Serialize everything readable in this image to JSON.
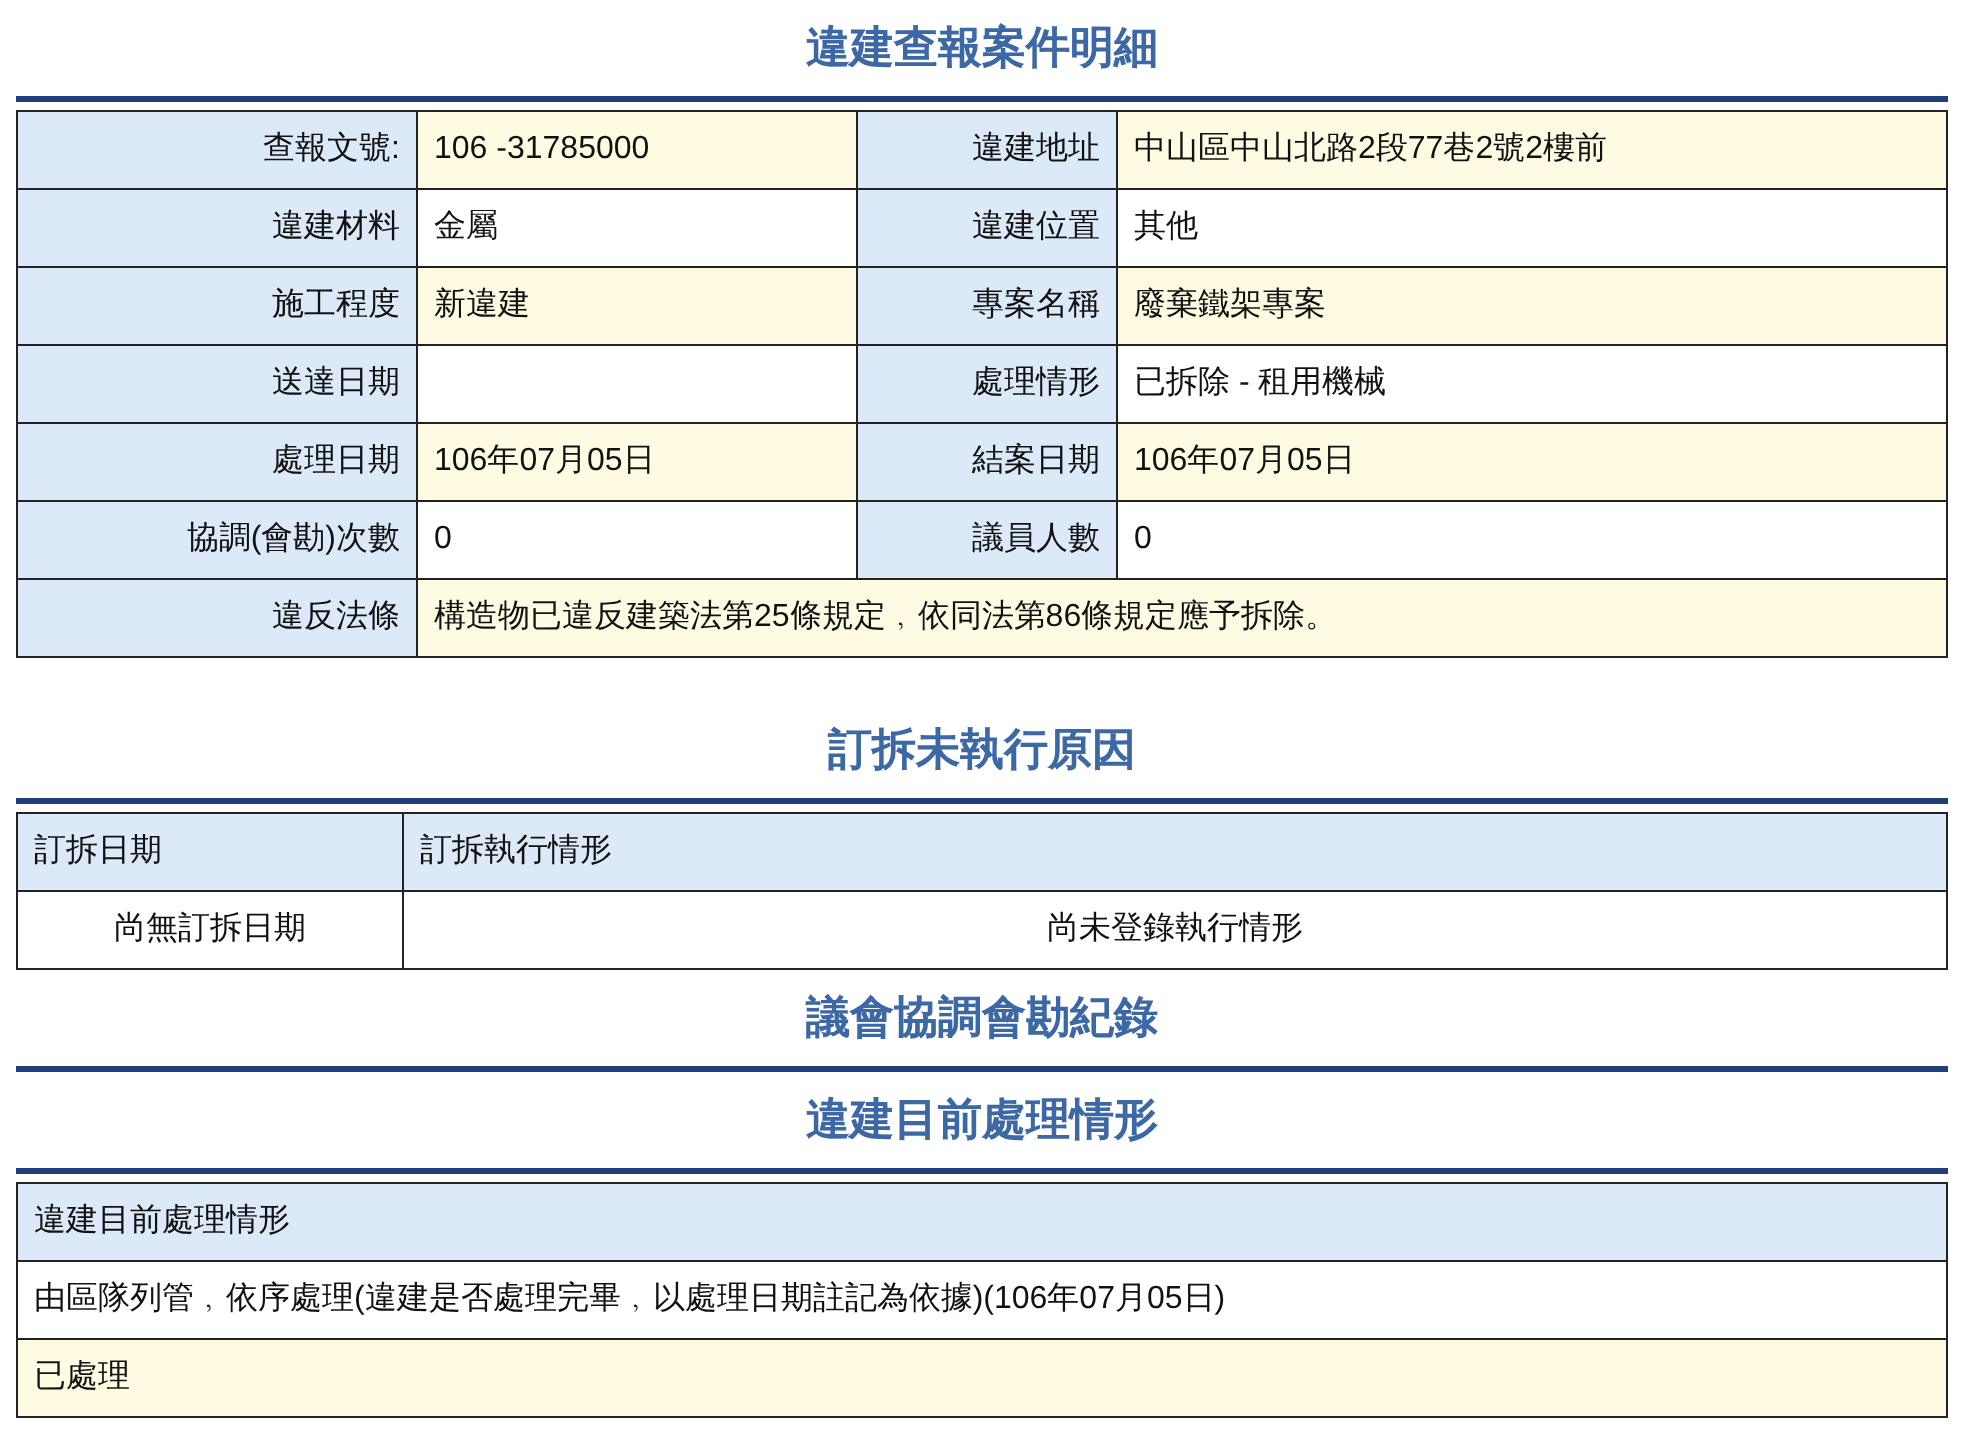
{
  "case_section": {
    "title": "違建查報案件明細",
    "rows": [
      {
        "cells": [
          {
            "label": "查報文號:",
            "value": "106 -31785000"
          },
          {
            "label": "違建地址",
            "value": "中山區中山北路2段77巷2號2樓前"
          }
        ]
      },
      {
        "cells": [
          {
            "label": "違建材料",
            "value": "金屬"
          },
          {
            "label": "違建位置",
            "value": "其他"
          }
        ]
      },
      {
        "cells": [
          {
            "label": "施工程度",
            "value": "新違建"
          },
          {
            "label": "專案名稱",
            "value": "廢棄鐵架專案"
          }
        ]
      },
      {
        "cells": [
          {
            "label": "送達日期"
          },
          {
            "label": "處理情形",
            "value": "已拆除 - 租用機械"
          }
        ]
      },
      {
        "cells": [
          {
            "label": "處理日期",
            "value": "106年07月05日"
          },
          {
            "label": "結案日期",
            "value": "106年07月05日"
          }
        ]
      },
      {
        "cells": [
          {
            "label": "協調(會勘)次數",
            "value": "0"
          },
          {
            "label": "議員人數",
            "value": "0"
          }
        ]
      },
      {
        "cells": [
          {
            "label": "違反法條",
            "value": "構造物已違反建築法第25條規定﹐依同法第86條規定應予拆除。"
          }
        ]
      }
    ]
  },
  "demolition_section": {
    "title": "訂拆未執行原因",
    "columns": [
      "訂拆日期",
      "訂拆執行情形"
    ],
    "rows": [
      [
        "尚無訂拆日期",
        "尚未登錄執行情形"
      ]
    ]
  },
  "council_section": {
    "title": "議會協調會勘紀錄"
  },
  "status_section": {
    "title": "違建目前處理情形",
    "header": "違建目前處理情形",
    "rows": [
      "由區隊列管﹐依序處理(違建是否處理完畢﹐以處理日期註記為依據)(106年07月05日)",
      "已處理"
    ]
  }
}
